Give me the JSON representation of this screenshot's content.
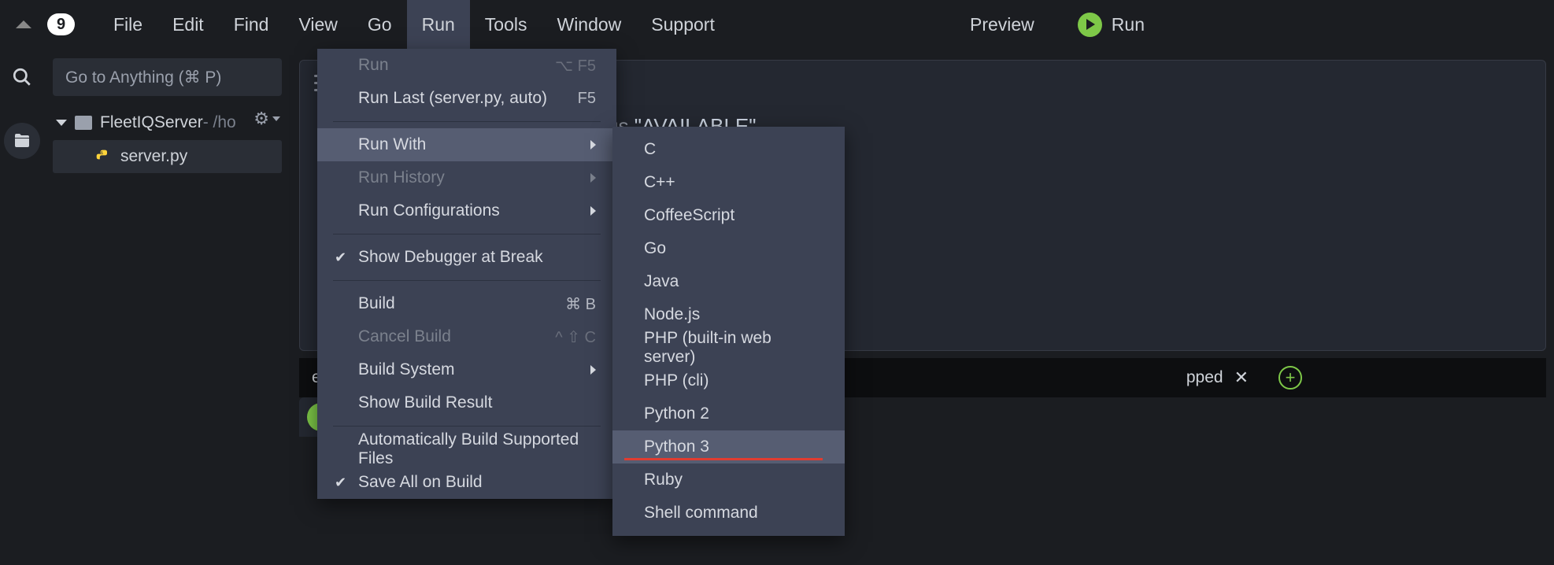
{
  "menubar": {
    "items": [
      "File",
      "Edit",
      "Find",
      "View",
      "Go",
      "Run",
      "Tools",
      "Window",
      "Support"
    ],
    "active_index": 5,
    "preview": "Preview",
    "run_button": "Run"
  },
  "sidebar": {
    "goto_placeholder": "Go to Anything (⌘ P)",
    "project_name": "FleetIQServer",
    "project_path": " - /ho",
    "file": "server.py"
  },
  "editor": {
    "code_prefix": "us ",
    "code_string": "\"AVAILABLE\""
  },
  "tabs": {
    "visible_suffix": "pped",
    "partial_prefix": "ec"
  },
  "run_menu": {
    "items": [
      {
        "label": "Run",
        "shortcut": "⌥ F5",
        "disabled": true,
        "type": "item"
      },
      {
        "label": "Run Last (server.py, auto)",
        "shortcut": "F5",
        "type": "item"
      },
      {
        "type": "sep"
      },
      {
        "label": "Run With",
        "type": "submenu",
        "highlighted": true
      },
      {
        "label": "Run History",
        "type": "submenu",
        "disabled": true
      },
      {
        "label": "Run Configurations",
        "type": "submenu"
      },
      {
        "type": "sep"
      },
      {
        "label": "Show Debugger at Break",
        "type": "check",
        "checked": true
      },
      {
        "type": "sep"
      },
      {
        "label": "Build",
        "shortcut": "⌘ B",
        "type": "item"
      },
      {
        "label": "Cancel Build",
        "shortcut": "^ ⇧ C",
        "disabled": true,
        "type": "item"
      },
      {
        "label": "Build System",
        "type": "submenu"
      },
      {
        "label": "Show Build Result",
        "type": "item"
      },
      {
        "type": "sep"
      },
      {
        "label": "Automatically Build Supported Files",
        "type": "item"
      },
      {
        "label": "Save All on Build",
        "type": "check",
        "checked": true
      }
    ]
  },
  "run_with_submenu": {
    "items": [
      "C",
      "C++",
      "CoffeeScript",
      "Go",
      "Java",
      "Node.js",
      "PHP (built-in web server)",
      "PHP (cli)",
      "Python 2",
      "Python 3",
      "Ruby",
      "Shell command"
    ],
    "highlighted_index": 9
  }
}
